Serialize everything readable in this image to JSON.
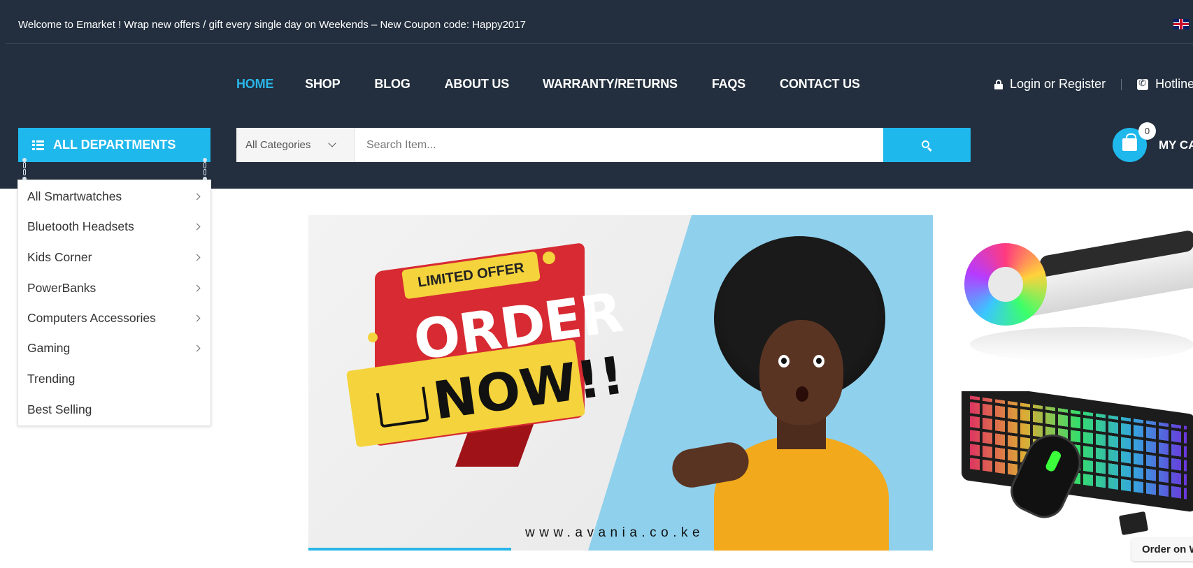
{
  "topbar": {
    "welcome_text": "Welcome to Emarket ! Wrap new offers / gift every single day on Weekends – New Coupon code: Happy2017",
    "language_icon": "uk-flag-icon"
  },
  "nav": {
    "items": [
      {
        "label": "HOME",
        "active": true
      },
      {
        "label": "SHOP",
        "active": false
      },
      {
        "label": "BLOG",
        "active": false
      },
      {
        "label": "ABOUT US",
        "active": false
      },
      {
        "label": "WARRANTY/RETURNS",
        "active": false
      },
      {
        "label": "FAQS",
        "active": false
      },
      {
        "label": "CONTACT US",
        "active": false
      }
    ]
  },
  "account": {
    "login_label": "Login or Register",
    "hotline_label": "Hotline"
  },
  "departments": {
    "button_label": "ALL DEPARTMENTS",
    "items": [
      {
        "label": "All Smartwatches",
        "has_submenu": true
      },
      {
        "label": "Bluetooth Headsets",
        "has_submenu": true
      },
      {
        "label": "Kids Corner",
        "has_submenu": true
      },
      {
        "label": "PowerBanks",
        "has_submenu": true
      },
      {
        "label": "Computers Accessories",
        "has_submenu": true
      },
      {
        "label": "Gaming",
        "has_submenu": true
      },
      {
        "label": "Trending",
        "has_submenu": false
      },
      {
        "label": "Best Selling",
        "has_submenu": false
      }
    ]
  },
  "search": {
    "category_selected": "All Categories",
    "placeholder": "Search Item...",
    "button_icon": "search-icon"
  },
  "cart": {
    "count": "0",
    "label": "MY CART"
  },
  "banner": {
    "tag": "LIMITED OFFER",
    "headline": "ORDER",
    "subline": "NOW!!",
    "url": "www.avania.co.ke"
  },
  "order_chip": {
    "label": "Order on WhatsApp"
  },
  "colors": {
    "header_bg": "#232f3e",
    "accent": "#1fb8ec",
    "nav_active": "#29b6e8"
  }
}
